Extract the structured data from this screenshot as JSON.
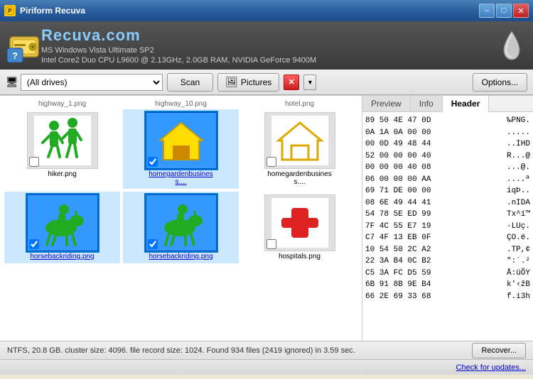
{
  "titlebar": {
    "title": "Piriform Recuva",
    "min_label": "–",
    "max_label": "□",
    "close_label": "✕"
  },
  "header": {
    "title": "Recuva",
    "title_suffix": ".com",
    "line1": "MS Windows Vista Ultimate SP2",
    "line2": "Intel Core2 Duo CPU L9600 @ 2.13GHz, 2.0GB RAM, NVIDIA GeForce 9400M"
  },
  "toolbar": {
    "drive_value": "(All drives)",
    "drive_placeholder": "(All drives)",
    "scan_label": "Scan",
    "pictures_label": "Pictures",
    "options_label": "Options...",
    "red_x": "✕"
  },
  "files": [
    {
      "id": 1,
      "name": "hiker.png",
      "type": "hiker",
      "selected": false,
      "checked": false
    },
    {
      "id": 2,
      "name": "homegardenbusiness....",
      "type": "home",
      "selected": true,
      "checked": true
    },
    {
      "id": 3,
      "name": "homegardenbusiness....",
      "type": "home_outline",
      "selected": false,
      "checked": false
    },
    {
      "id": 4,
      "name": "horsebackriding.png",
      "type": "horse",
      "selected": true,
      "checked": true
    },
    {
      "id": 5,
      "name": "horsebackriding.png",
      "type": "horse",
      "selected": true,
      "checked": true
    },
    {
      "id": 6,
      "name": "hospitals.png",
      "type": "cross",
      "selected": false,
      "checked": false
    }
  ],
  "top_files": [
    "highway_1.png",
    "highway_10.png",
    "hotel.png"
  ],
  "tabs": [
    "Preview",
    "Info",
    "Header"
  ],
  "active_tab": "Header",
  "hex_rows": [
    {
      "bytes": "89 50 4E 47 0D",
      "chars": "‰PNG."
    },
    {
      "bytes": "0A 1A 0A 00 00",
      "chars": "....."
    },
    {
      "bytes": "00 0D 49 48 44",
      "chars": "..IHD"
    },
    {
      "bytes": "52 00 00 00 40",
      "chars": "R...@"
    },
    {
      "bytes": "00 00 00 40 08",
      "chars": "...@."
    },
    {
      "bytes": "06 00 00 00 AA",
      "chars": "....ª"
    },
    {
      "bytes": "69 71 DE 00 00",
      "chars": "iqÞ.."
    },
    {
      "bytes": "08 6E 49 44 41",
      "chars": ".nIDA"
    },
    {
      "bytes": "54 78 5E ED 99",
      "chars": "Tx^í™"
    },
    {
      "bytes": "7F 4C 55 E7 19",
      "chars": ".LUç."
    },
    {
      "bytes": "C7 4F 13 EB 0F",
      "chars": "ÇO.ë."
    },
    {
      "bytes": "10 54 50 2C A2",
      "chars": ".TP,¢"
    },
    {
      "bytes": "22 3A B4 0C B2",
      "chars": "\":´.²"
    },
    {
      "bytes": "C5 3A FC D5 59",
      "chars": "Å:üÕY"
    },
    {
      "bytes": "6B 91 8B 9E B4",
      "chars": "k'‹žB"
    },
    {
      "bytes": "66 2E 69 33 68",
      "chars": "f.i3h"
    }
  ],
  "status": {
    "text": "NTFS, 20.8 GB. cluster size: 4096. file record size: 1024. Found 934 files (2419 ignored) in 3.59 sec.",
    "recover_label": "Recover...",
    "check_updates_label": "Check for updates..."
  }
}
